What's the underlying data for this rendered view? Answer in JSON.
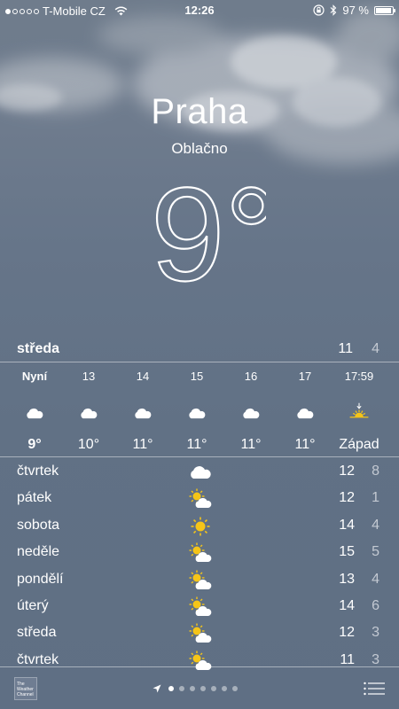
{
  "status_bar": {
    "carrier": "T-Mobile CZ",
    "signal_bars_filled": 1,
    "signal_bars_total": 5,
    "time": "12:26",
    "battery_text": "97 %",
    "battery_level": 0.97
  },
  "location": {
    "city": "Praha",
    "condition": "Oblačno",
    "temperature": "9°"
  },
  "today": {
    "day": "středa",
    "high": "11",
    "low": "4"
  },
  "hourly": [
    {
      "time": "Nyní",
      "icon": "cloud-icon",
      "temp": "9°"
    },
    {
      "time": "13",
      "icon": "cloud-icon",
      "temp": "10°"
    },
    {
      "time": "14",
      "icon": "cloud-icon",
      "temp": "11°"
    },
    {
      "time": "15",
      "icon": "cloud-icon",
      "temp": "11°"
    },
    {
      "time": "16",
      "icon": "cloud-icon",
      "temp": "11°"
    },
    {
      "time": "17",
      "icon": "cloud-icon",
      "temp": "11°"
    },
    {
      "time": "17:59",
      "icon": "sunset-icon",
      "temp": "Západ"
    }
  ],
  "daily": [
    {
      "day": "čtvrtek",
      "icon": "cloud-icon",
      "high": "12",
      "low": "8"
    },
    {
      "day": "pátek",
      "icon": "partly-cloudy-icon",
      "high": "12",
      "low": "1"
    },
    {
      "day": "sobota",
      "icon": "sun-icon",
      "high": "14",
      "low": "4"
    },
    {
      "day": "neděle",
      "icon": "partly-cloudy-icon",
      "high": "15",
      "low": "5"
    },
    {
      "day": "pondělí",
      "icon": "partly-cloudy-icon",
      "high": "13",
      "low": "4"
    },
    {
      "day": "úterý",
      "icon": "partly-cloudy-icon",
      "high": "14",
      "low": "6"
    },
    {
      "day": "středa",
      "icon": "partly-cloudy-icon",
      "high": "12",
      "low": "3"
    },
    {
      "day": "čtvrtek",
      "icon": "partly-cloudy-icon",
      "high": "11",
      "low": "3"
    }
  ],
  "bottom_bar": {
    "logo_text": "The Weather Channel",
    "page_count": 7,
    "active_page": 0
  },
  "colors": {
    "sun": "#f5c518",
    "low_temp": "#c3c9d2"
  }
}
